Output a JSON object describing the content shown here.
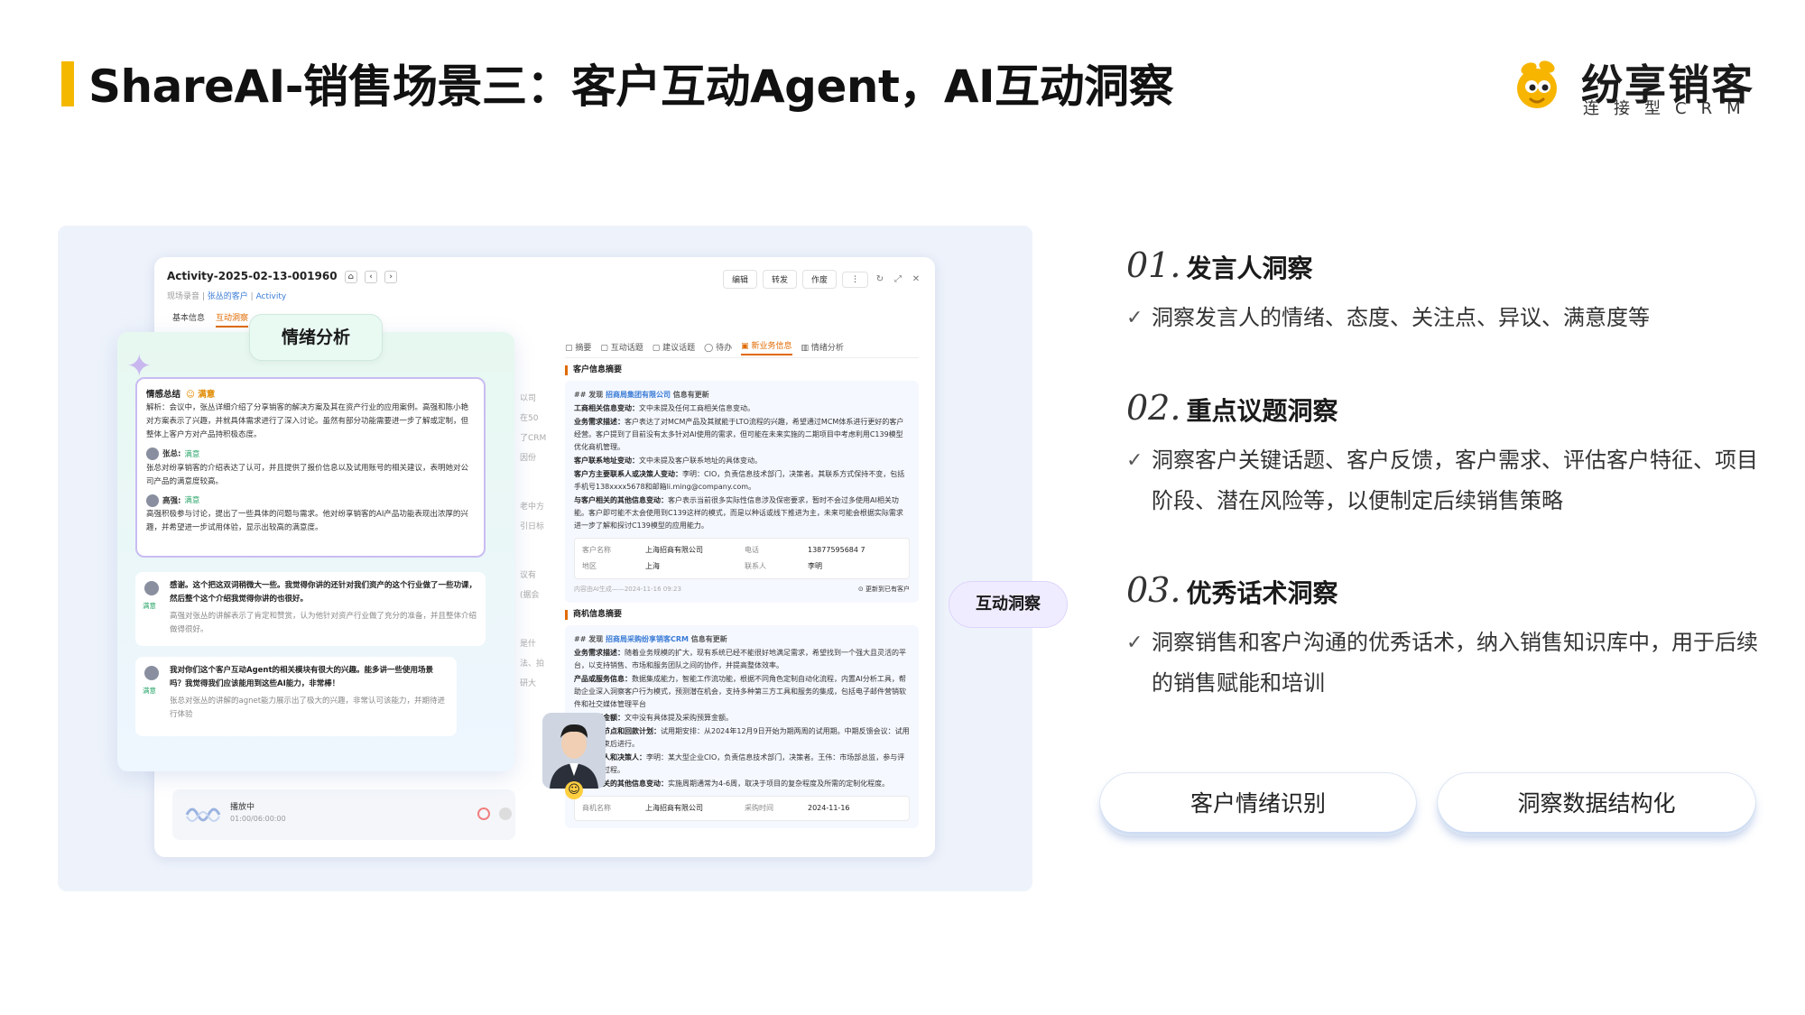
{
  "slide": {
    "title": "ShareAI-销售场景三：客户互动Agent，AI互动洞察"
  },
  "logo": {
    "name": "纷享销客",
    "subtitle": "连接型CRM"
  },
  "app": {
    "activity_title": "Activity-2025-02-13-001960",
    "breadcrumb": [
      "现场录音",
      "张丛的客户",
      "Activity"
    ],
    "actions": [
      "编辑",
      "转发",
      "作废"
    ],
    "subtabs": [
      "基本信息",
      "互动洞察"
    ],
    "side_strip": [
      "以司",
      "在50",
      "了CRM",
      "因份",
      "老中方",
      "引日标",
      "议有",
      "(据会",
      "是什",
      "法、拍",
      "研大"
    ],
    "right_tabs": [
      "摘要",
      "互动话题",
      "建议话题",
      "待办",
      "新业务信息",
      "情绪分析"
    ],
    "customer_section": {
      "heading": "客户信息摘要",
      "found_prefix": "## 发现",
      "company": "招商局集团有限公司",
      "found_suffix": "信息有更新",
      "items": [
        {
          "k": "工商相关信息变动：",
          "v": "文中未提及任何工商相关信息变动。"
        },
        {
          "k": "业务需求描述：",
          "v": "客户表达了对MCM产品及其赋能于LTO流程的兴趣，希望通过MCM体系进行更好的客户经营。客户提到了目前没有太多针对AI使用的需求，但可能在未来实施的二期项目中考虑利用C139模型优化商机管理。"
        },
        {
          "k": "客户联系地址变动：",
          "v": "文中未提及客户联系地址的具体变动。"
        },
        {
          "k": "客户方主要联系人或决策人变动：",
          "v": "李明：CIO，负责信息技术部门，决策者。其联系方式保持不变，包括手机号138xxxx5678和邮箱li.ming@company.com。"
        },
        {
          "k": "与客户相关的其他信息变动：",
          "v": "客户表示当前很多实际性信息涉及保密要求，暂时不会过多使用AI相关功能。客户即可能不太会使用到C139这样的模式，而是以种话或线下推进为主，未来可能会根据实际需求进一步了解和探讨C139模型的应用能力。"
        }
      ],
      "grid": [
        {
          "k": "客户名称",
          "v": "上海招商有限公司"
        },
        {
          "k": "电话",
          "v": "13877595684 7"
        },
        {
          "k": "地区",
          "v": "上海"
        },
        {
          "k": "联系人",
          "v": "李明"
        }
      ],
      "note": "内容由AI生成——2024-11-16 09:23",
      "update_btn": "更新到已有客户"
    },
    "opportunity_section": {
      "heading": "商机信息摘要",
      "found_prefix": "## 发现",
      "company": "招商局采购纷享销客CRM",
      "found_suffix": "信息有更新",
      "items": [
        {
          "k": "业务需求描述：",
          "v": "随着业务规模的扩大，现有系统已经不能很好地满足需求，希望找到一个强大且灵活的平台，以支持销售、市场和服务团队之间的协作，并提高整体效率。"
        },
        {
          "k": "产品或服务信息：",
          "v": "数据集成能力，智能工作流功能，根据不同角色定制自动化流程，内置AI分析工具，帮助企业深入洞察客户行为模式，预测潜在机会，支持多种第三方工具和服务的集成，包括电子邮件营销软件和社交媒体管理平台"
        },
        {
          "k": "采购预算金额：",
          "v": "文中没有具体提及采购预算金额。"
        },
        {
          "k": "项目时间节点和回款计划：",
          "v": "试用期安排：从2024年12月9日开始为期两周的试用期。中期反馈会议：试用第一周结束后进行。"
        },
        {
          "k": "主要联系人和决策人：",
          "v": "李明：某大型企业CIO，负责信息技术部门，决策者。王伟：市场部总监，参与评估和决策过程。"
        },
        {
          "k": "与商机相关的其他信息变动：",
          "v": "实施周期通常为4-6周，取决于项目的复杂程度及所需的定制化程度。"
        }
      ],
      "grid": [
        {
          "k": "商机名称",
          "v": "上海招商有限公司"
        },
        {
          "k": "采购时间",
          "v": "2024-11-16"
        }
      ]
    },
    "player": {
      "label": "播放中",
      "time": "01:00/06:00:00"
    }
  },
  "emotion_panel": {
    "tag": "情绪分析",
    "summary_heading": "情感总结",
    "summary_mood": "满意",
    "summary_text": "解析：会议中，张丛详细介绍了分享销客的解决方案及其在资产行业的应用案例。高强和陈小艳对方案表示了兴趣，并就具体需求进行了深入讨论。虽然有部分功能需要进一步了解或定制，但整体上客户方对产品持积极态度。",
    "speaker1_name": "张总:",
    "speaker1_mood": "满意",
    "speaker1_text": "张总对纷享销客的介绍表达了认可，并且提供了报价信息以及试用账号的相关建议，表明她对公司产品的满意度较高。",
    "speaker2_name": "高强:",
    "speaker2_mood": "满意",
    "speaker2_text": "高强积极参与讨论，提出了一些具体的问题与需求。他对纷享销客的AI产品功能表现出浓厚的兴趣，并希望进一步试用体验，显示出较高的满意度。",
    "chat1_q": "感谢。这个把这双词稍微大一些。我觉得你讲的还针对我们资产的这个行业做了一些功课，然后整个这个介绍我觉得你讲的也很好。",
    "chat1_a": "高强对张丛的讲解表示了肯定和赞赏，认为他针对资产行业做了充分的准备，并且整体介绍做得很好。",
    "chat2_q": "我对你们这个客户互动Agent的相关模块有很大的兴趣。能多讲一些使用场景吗？我觉得我们应该能用到这些AI能力，非常棒！",
    "chat2_a": "张总对张丛的讲解的agnet能力展示出了极大的兴趣，非常认可该能力，并期待进行体验",
    "chat_mood_label": "满意"
  },
  "insight_tag": "互动洞察",
  "points": [
    {
      "num": "01.",
      "title": "发言人洞察",
      "desc": "洞察发言人的情绪、态度、关注点、异议、满意度等"
    },
    {
      "num": "02.",
      "title": "重点议题洞察",
      "desc": "洞察客户关键话题、客户反馈，客户需求、评估客户特征、项目阶段、潜在风险等，以便制定后续销售策略"
    },
    {
      "num": "03.",
      "title": "优秀话术洞察",
      "desc": "洞察销售和客户沟通的优秀话术，纳入销售知识库中，用于后续的销售赋能和培训"
    }
  ],
  "pills": [
    "客户情绪识别",
    "洞察数据结构化"
  ],
  "colors": {
    "accent": "#f5b800",
    "orange": "#e06a00",
    "link": "#3a7bd5",
    "panel_bg": "#eef3fb"
  }
}
